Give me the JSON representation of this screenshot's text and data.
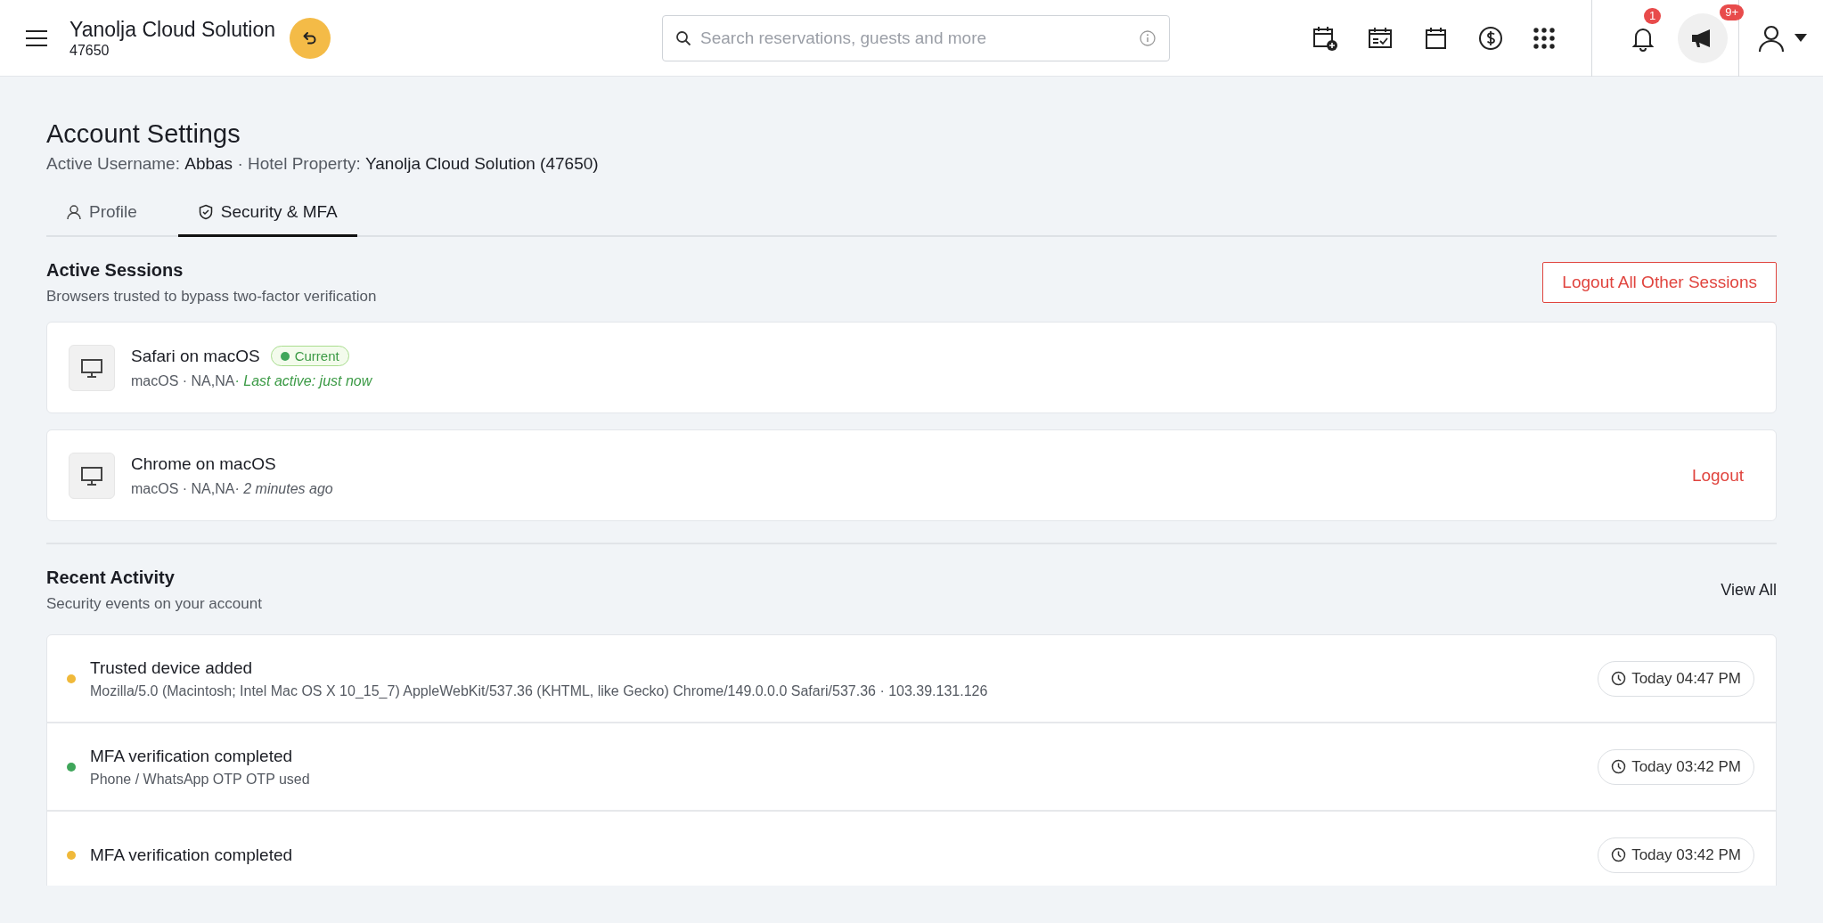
{
  "header": {
    "property_name": "Yanolja Cloud Solution",
    "property_id": "47650",
    "search": {
      "placeholder": "Search reservations, guests and more"
    },
    "notification_badge": "1",
    "announcement_badge": "9+"
  },
  "page": {
    "title": "Account Settings",
    "subtitle": "Active Username: **Abbas** · Hotel Property: **Yanolja Cloud Solution (47650)**"
  },
  "tabs": [
    {
      "label": "Profile",
      "selected": false
    },
    {
      "label": "Security & MFA",
      "selected": true
    }
  ],
  "active_sessions": {
    "title": "Active Sessions",
    "description": "Browsers trusted to bypass two-factor verification",
    "logout_all": "Logout All Other Sessions",
    "sessions": [
      {
        "name": "Safari on macOS",
        "current": true,
        "badge": "Current",
        "meta": "macOS · NA,NA",
        "last_active": "· Last active: just now"
      },
      {
        "name": "Chrome on macOS",
        "current": false,
        "meta": "macOS · NA,NA",
        "last_active": "· 2 minutes ago",
        "action": "Logout"
      }
    ]
  },
  "recent_activity": {
    "title": "Recent Activity",
    "description": "Security events on your account",
    "view_all": "View All",
    "events": [
      {
        "title": "Trusted device added",
        "detail": "Mozilla/5.0 (Macintosh; Intel Mac OS X 10_15_7) AppleWebKit/537.36 (KHTML, like Gecko) Chrome/149.0.0.0 Safari/537.36 · 103.39.131.126",
        "time": "Today 04:47 PM",
        "color": "#f0b93a"
      },
      {
        "title": "MFA verification completed",
        "detail": "Phone / WhatsApp OTP OTP used",
        "time": "Today 03:42 PM",
        "color": "#3fa65a"
      },
      {
        "title": "MFA verification completed",
        "time": "Today 03:42 PM",
        "color": "#f0b93a"
      }
    ]
  }
}
